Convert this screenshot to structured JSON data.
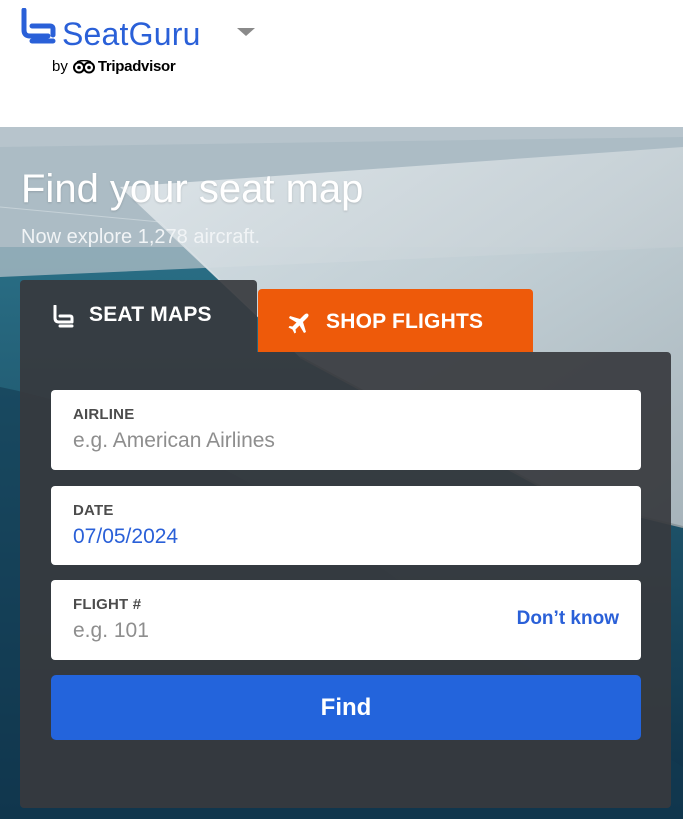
{
  "brand": {
    "name": "SeatGuru",
    "byline_prefix": "by",
    "byline_brand": "Tripadvisor",
    "color": "#2a60d8"
  },
  "hero": {
    "title": "Find your seat map",
    "subtitle": "Now explore 1,278 aircraft."
  },
  "tabs": [
    {
      "label": "SEAT MAPS",
      "icon": "seat-icon",
      "active": true
    },
    {
      "label": "SHOP FLIGHTS",
      "icon": "airplane-icon",
      "active": false,
      "color": "#ee5a0a"
    }
  ],
  "form": {
    "airline": {
      "label": "AIRLINE",
      "placeholder": "e.g. American Airlines"
    },
    "date": {
      "label": "DATE",
      "value": "07/05/2024"
    },
    "flight": {
      "label": "FLIGHT #",
      "placeholder": "e.g. 101",
      "dont_know": "Don’t know"
    },
    "find_label": "Find",
    "find_color": "#2364dc"
  }
}
